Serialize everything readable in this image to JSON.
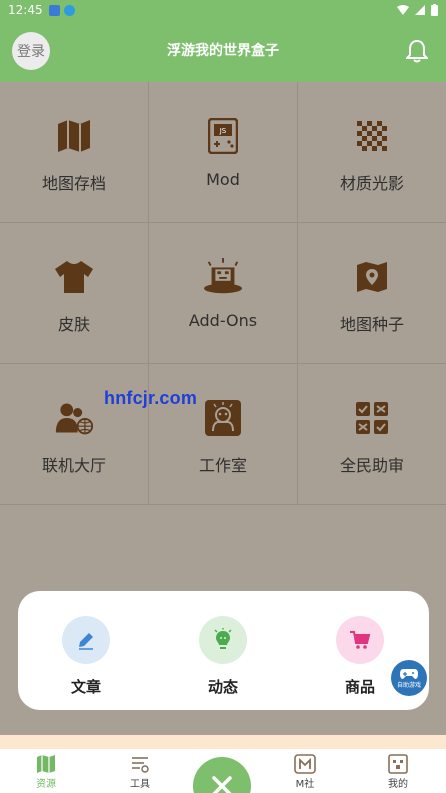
{
  "status_bar": {
    "time": "12:45"
  },
  "header": {
    "login_label": "登录",
    "title": "浮游我的世界盒子"
  },
  "grid": {
    "items": [
      {
        "label": "地图存档",
        "icon": "map-icon"
      },
      {
        "label": "Mod",
        "icon": "js-console-icon"
      },
      {
        "label": "材质光影",
        "icon": "checkerboard-icon"
      },
      {
        "label": "皮肤",
        "icon": "tshirt-icon"
      },
      {
        "label": "Add-Ons",
        "icon": "magic-hat-icon"
      },
      {
        "label": "地图种子",
        "icon": "map-seed-icon"
      },
      {
        "label": "联机大厅",
        "icon": "multiplayer-icon"
      },
      {
        "label": "工作室",
        "icon": "studio-icon"
      },
      {
        "label": "全民助审",
        "icon": "review-icon"
      }
    ]
  },
  "watermark": "hnfcjr.com",
  "popup": {
    "items": [
      {
        "label": "文章",
        "icon": "pencil-icon",
        "bg": "#dbe9f7",
        "fg": "#3d86d6"
      },
      {
        "label": "动态",
        "icon": "bulb-icon",
        "bg": "#dcefdb",
        "fg": "#4aab4f"
      },
      {
        "label": "商品",
        "icon": "cart-icon",
        "bg": "#fbd9ea",
        "fg": "#e0357f"
      }
    ]
  },
  "floating_game": {
    "label": "自助游戏"
  },
  "tabs": {
    "items": [
      {
        "label": "资源",
        "icon": "map-tab-icon"
      },
      {
        "label": "工具",
        "icon": "tools-tab-icon"
      },
      {
        "label": "M社",
        "icon": "m-community-tab-icon"
      },
      {
        "label": "我的",
        "icon": "profile-tab-icon"
      }
    ]
  },
  "colors": {
    "accent": "#7dbf6d",
    "grid_bg": "#a8a095",
    "icon_brown": "#5b3818"
  }
}
